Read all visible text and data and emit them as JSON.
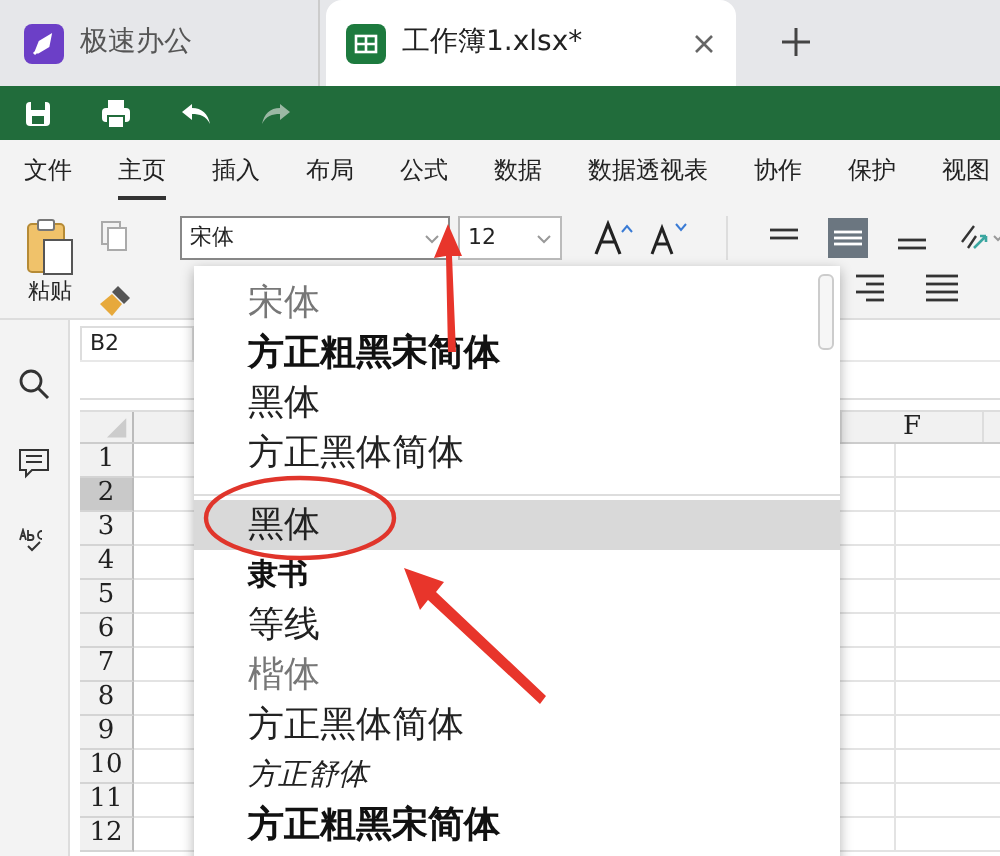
{
  "tabs": [
    {
      "label": "极速办公",
      "selected": false,
      "kind": "app"
    },
    {
      "label": "工作簿1.xlsx*",
      "selected": true,
      "kind": "document"
    }
  ],
  "menu": [
    {
      "label": "文件",
      "selected": false
    },
    {
      "label": "主页",
      "selected": true
    },
    {
      "label": "插入",
      "selected": false
    },
    {
      "label": "布局",
      "selected": false
    },
    {
      "label": "公式",
      "selected": false
    },
    {
      "label": "数据",
      "selected": false
    },
    {
      "label": "数据透视表",
      "selected": false
    },
    {
      "label": "协作",
      "selected": false
    },
    {
      "label": "保护",
      "selected": false
    },
    {
      "label": "视图",
      "selected": false
    }
  ],
  "ribbon": {
    "paste_label": "粘贴",
    "font_name": "宋体",
    "font_size": "12"
  },
  "name_box": "B2",
  "sheet": {
    "column_headers": [
      "F"
    ],
    "rows": [
      {
        "label": "1",
        "selected": false
      },
      {
        "label": "2",
        "selected": true
      },
      {
        "label": "3",
        "selected": false
      },
      {
        "label": "4",
        "selected": false
      },
      {
        "label": "5",
        "selected": false
      },
      {
        "label": "6",
        "selected": false
      },
      {
        "label": "7",
        "selected": false
      },
      {
        "label": "8",
        "selected": false
      },
      {
        "label": "9",
        "selected": false
      },
      {
        "label": "10",
        "selected": false
      },
      {
        "label": "11",
        "selected": false
      },
      {
        "label": "12",
        "selected": false
      }
    ]
  },
  "font_dropdown": {
    "recent": [
      {
        "label": "宋体",
        "kind": "light",
        "selected": false
      },
      {
        "label": "方正粗黑宋简体",
        "kind": "bold",
        "selected": false
      },
      {
        "label": "黑体",
        "kind": "regular",
        "selected": false
      },
      {
        "label": "方正黑体简体",
        "kind": "regular",
        "selected": false
      }
    ],
    "all": [
      {
        "label": "黑体",
        "kind": "regular",
        "selected": true
      },
      {
        "label": "隶书",
        "kind": "clerical",
        "selected": false
      },
      {
        "label": "等线",
        "kind": "regular",
        "selected": false
      },
      {
        "label": "楷体",
        "kind": "light",
        "selected": false
      },
      {
        "label": "方正黑体简体",
        "kind": "regular",
        "selected": false
      },
      {
        "label": "方正舒体",
        "kind": "script",
        "selected": false
      },
      {
        "label": "方正粗黑宋简体",
        "kind": "bold",
        "selected": false
      }
    ]
  }
}
